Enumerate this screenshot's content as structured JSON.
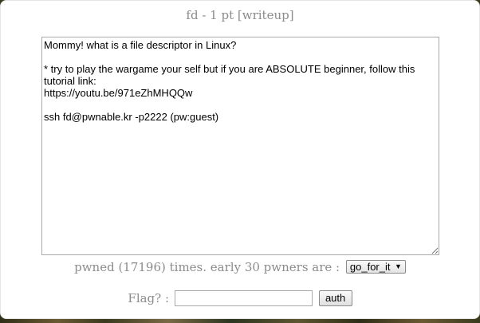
{
  "challenge": {
    "title": "fd - 1 pt [writeup]",
    "description": "Mommy! what is a file descriptor in Linux?\n\n* try to play the wargame your self but if you are ABSOLUTE beginner, follow this tutorial link:\nhttps://youtu.be/971eZhMHQQw\n\nssh fd@pwnable.kr -p2222 (pw:guest)"
  },
  "stats": {
    "pwned_text": "pwned (17196) times. early 30 pwners are :",
    "pwners_select": {
      "selected": "go_for_it"
    }
  },
  "flag_form": {
    "label": "Flag? :",
    "input_value": "",
    "submit_label": "auth"
  },
  "icons": {
    "dropdown": "chevron-down-icon",
    "resize": "resize-grip-icon"
  }
}
